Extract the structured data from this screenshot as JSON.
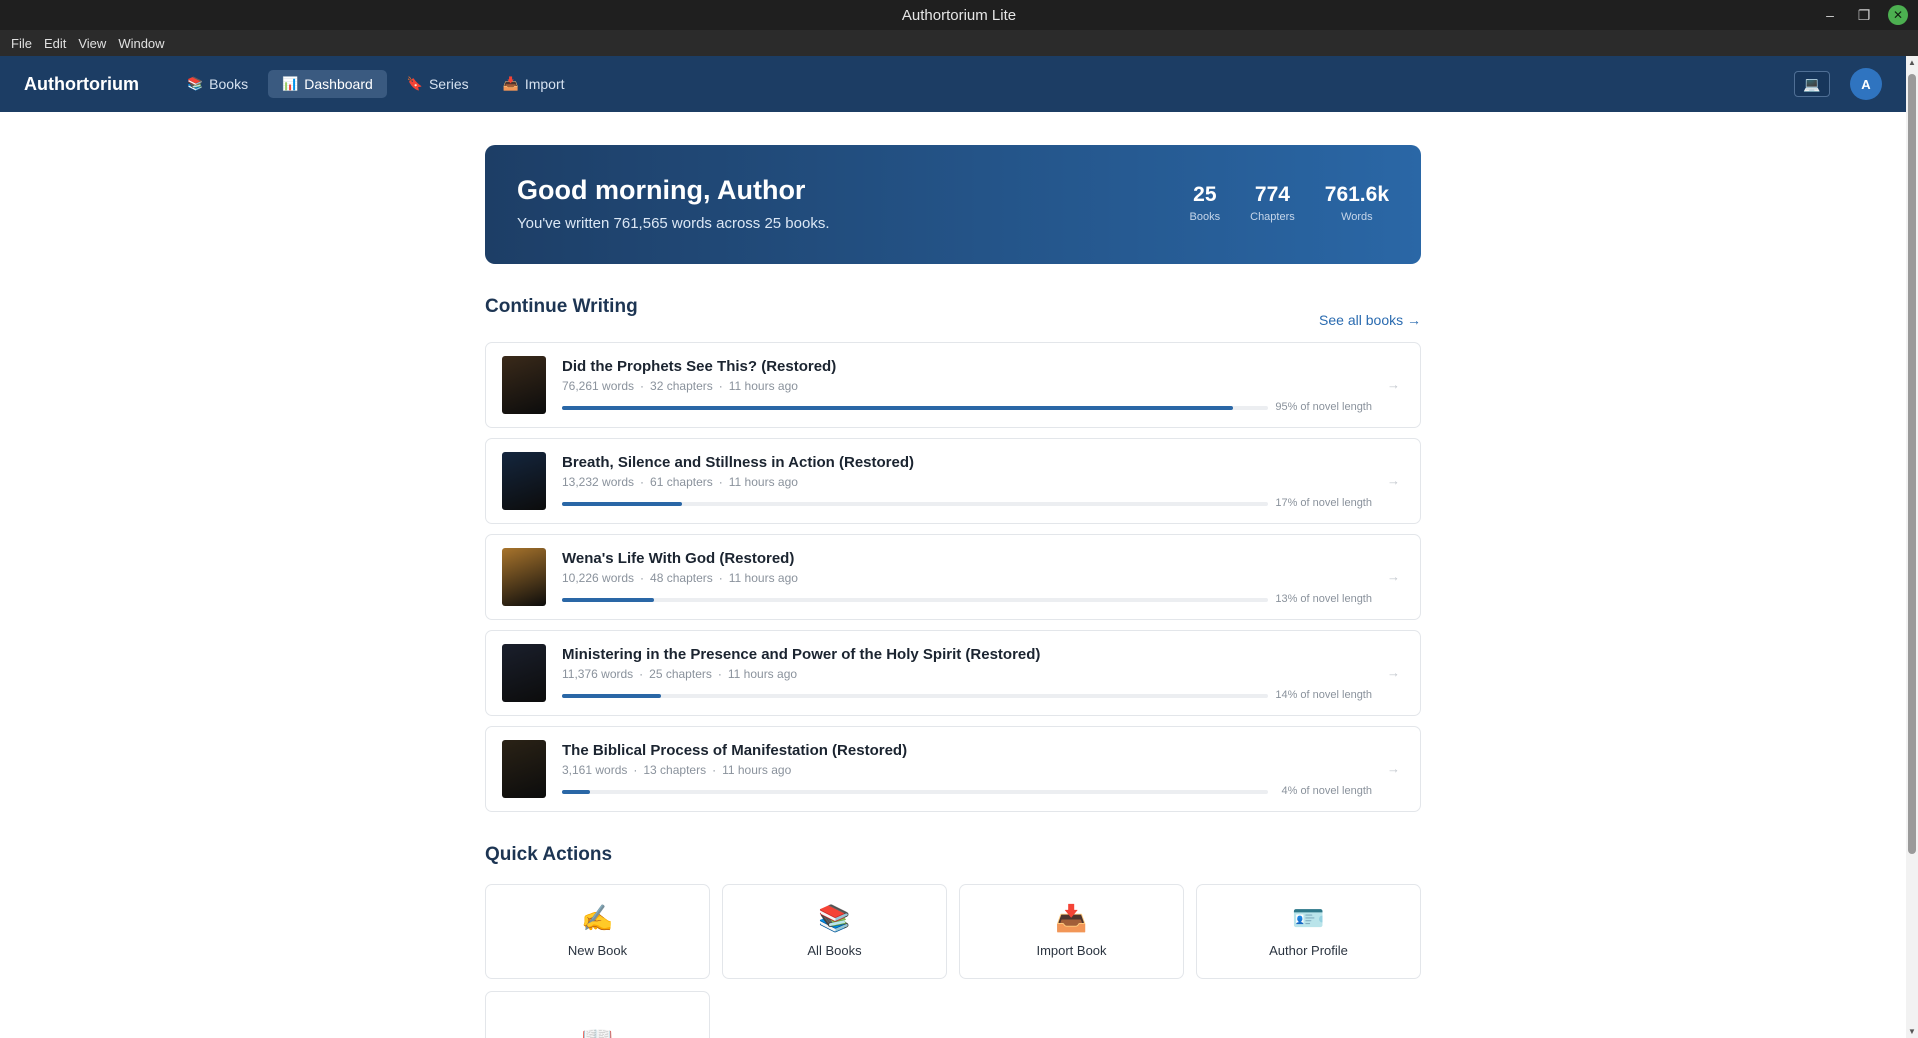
{
  "window": {
    "title": "Authortorium Lite",
    "controls": {
      "minimize": "–",
      "maximize": "❐",
      "close": "✕"
    }
  },
  "menu": [
    "File",
    "Edit",
    "View",
    "Window"
  ],
  "header": {
    "brand": "Authortorium",
    "nav": [
      {
        "label": "Books",
        "icon": "books-icon",
        "glyph": "📚"
      },
      {
        "label": "Dashboard",
        "icon": "chart-icon",
        "glyph": "📊"
      },
      {
        "label": "Series",
        "icon": "bookmark-icon",
        "glyph": "🔖"
      },
      {
        "label": "Import",
        "icon": "inbox-icon",
        "glyph": "📥"
      }
    ],
    "device_glyph": "💻",
    "avatar_initial": "A"
  },
  "hero": {
    "greeting": "Good morning, Author",
    "subtitle": "You've written 761,565 words across 25 books.",
    "stats": [
      {
        "value": "25",
        "label": "Books"
      },
      {
        "value": "774",
        "label": "Chapters"
      },
      {
        "value": "761.6k",
        "label": "Words"
      }
    ]
  },
  "continue": {
    "title": "Continue Writing",
    "see_all": "See all books →",
    "books": [
      {
        "title": "Did the Prophets See This? (Restored)",
        "words": "76,261 words",
        "chapters": "32 chapters",
        "updated": "11 hours ago",
        "progress": 95,
        "progress_label": "95% of novel length",
        "cover_color": "#3a2a1a"
      },
      {
        "title": "Breath, Silence and Stillness in Action (Restored)",
        "words": "13,232 words",
        "chapters": "61 chapters",
        "updated": "11 hours ago",
        "progress": 17,
        "progress_label": "17% of novel length",
        "cover_color": "#14263e"
      },
      {
        "title": "Wena's Life With God (Restored)",
        "words": "10,226 words",
        "chapters": "48 chapters",
        "updated": "11 hours ago",
        "progress": 13,
        "progress_label": "13% of novel length",
        "cover_color": "#a8742c"
      },
      {
        "title": "Ministering in the Presence and Power of the Holy Spirit (Restored)",
        "words": "11,376 words",
        "chapters": "25 chapters",
        "updated": "11 hours ago",
        "progress": 14,
        "progress_label": "14% of novel length",
        "cover_color": "#1a1f2c"
      },
      {
        "title": "The Biblical Process of Manifestation (Restored)",
        "words": "3,161 words",
        "chapters": "13 chapters",
        "updated": "11 hours ago",
        "progress": 4,
        "progress_label": "4% of novel length",
        "cover_color": "#2a2216"
      }
    ],
    "row_arrow": "→"
  },
  "quick_actions": {
    "title": "Quick Actions",
    "items": [
      {
        "label": "New Book",
        "icon": "writing-hand-icon",
        "glyph": "✍️"
      },
      {
        "label": "All Books",
        "icon": "books-icon",
        "glyph": "📚"
      },
      {
        "label": "Import Book",
        "icon": "inbox-icon",
        "glyph": "📥"
      },
      {
        "label": "Author Profile",
        "icon": "id-card-icon",
        "glyph": "🪪"
      },
      {
        "label": "",
        "icon": "open-book-icon",
        "glyph": "📖"
      }
    ]
  }
}
